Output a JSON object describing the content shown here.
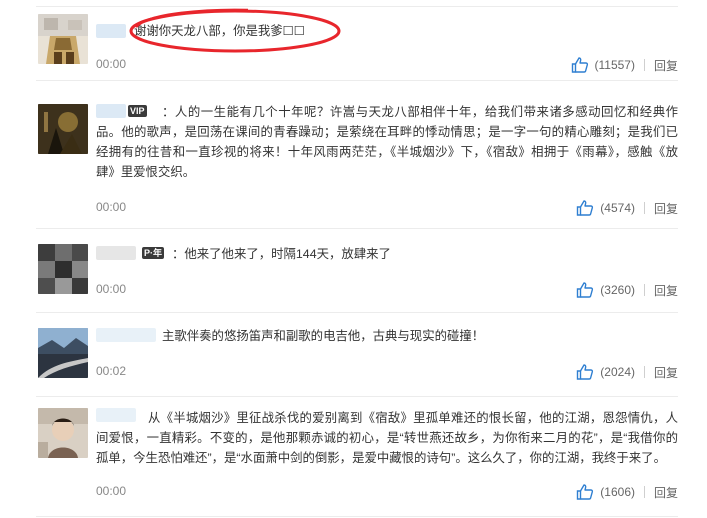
{
  "comments": [
    {
      "text": "谢谢你天龙八部，你是我爹☐☐",
      "time": "00:00",
      "likes": "(11557)",
      "reply_label": "回复"
    },
    {
      "badge": "VIP",
      "text": "：人的一生能有几个十年呢？许嵩与天龙八部相伴十年，给我们带来诸多感动回忆和经典作品。他的歌声，是回荡在课间的青春躁动；是萦绕在耳畔的悸动情思；是一字一句的精心雕刻；是我们已经拥有的往昔和一直珍视的将来！十年风雨两茫茫，《半城烟沙》下，《宿敌》相拥于《雨幕》，感触《放肆》里爱恨交织。",
      "time": "00:00",
      "likes": "(4574)",
      "reply_label": "回复"
    },
    {
      "badge": "P·年",
      "text": "：他来了他来了，时隔144天，放肆来了",
      "time": "00:00",
      "likes": "(3260)",
      "reply_label": "回复"
    },
    {
      "text": "主歌伴奏的悠扬笛声和副歌的电吉他，古典与现实的碰撞！",
      "time": "00:02",
      "likes": "(2024)",
      "reply_label": "回复"
    },
    {
      "text": "从《半城烟沙》里征战杀伐的爱别离到《宿敌》里孤单难还的恨长留，他的江湖，恩怨情仇，人间爱恨，一直精彩。不变的，是他那颗赤诚的初心，是“转世燕还故乡，为你衔来二月的花”，是“我借你的孤单，今生恐怕难还”，是“水面萧中剑的倒影，是爱中藏恨的诗句”。这么久了，你的江湖，我终于来了。",
      "time": "00:00",
      "likes": "(1606)",
      "reply_label": "回复"
    }
  ],
  "colors": {
    "circle": "#e8262c",
    "like_icon": "#2f7fd1"
  },
  "icons": {
    "like": "thumbs-up-icon"
  }
}
